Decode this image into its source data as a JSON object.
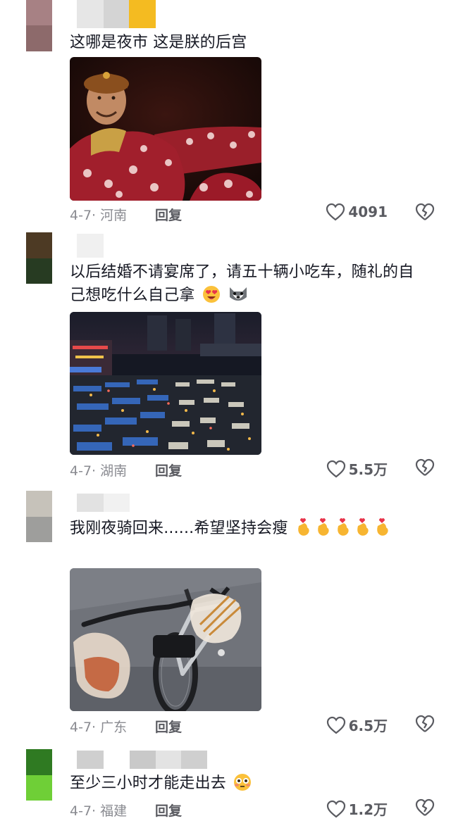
{
  "comments": [
    {
      "text": "这哪是夜市  这是朕的后宫",
      "date": "4-7",
      "location": "河南",
      "reply_label": "回复",
      "likes": "4091",
      "image_icon": "tv-drama-still-image"
    },
    {
      "text": "以后结婚不请宴席了，请五十辆小吃车，随礼的自己想吃什么自己拿",
      "emojis": [
        "heart-eyes-emoji",
        "dog-face-emoji"
      ],
      "date": "4-7",
      "location": "湖南",
      "reply_label": "回复",
      "likes": "5.5万",
      "image_icon": "night-market-aerial-image"
    },
    {
      "text": "我刚夜骑回来......希望坚持会瘦",
      "emojis": [
        "finger-heart-emoji",
        "finger-heart-emoji",
        "finger-heart-emoji",
        "finger-heart-emoji",
        "finger-heart-emoji"
      ],
      "date": "4-7",
      "location": "广东",
      "reply_label": "回复",
      "likes": "6.5万",
      "image_icon": "bicycle-with-snacks-image"
    },
    {
      "text": "至少三小时才能走出去",
      "emojis": [
        "flushed-face-emoji"
      ],
      "date": "4-7",
      "location": "福建",
      "reply_label": "回复",
      "likes": "1.2万"
    }
  ],
  "colors": {
    "text": "#161823",
    "meta": "#8a8b91",
    "icon": "#5a5b61"
  }
}
